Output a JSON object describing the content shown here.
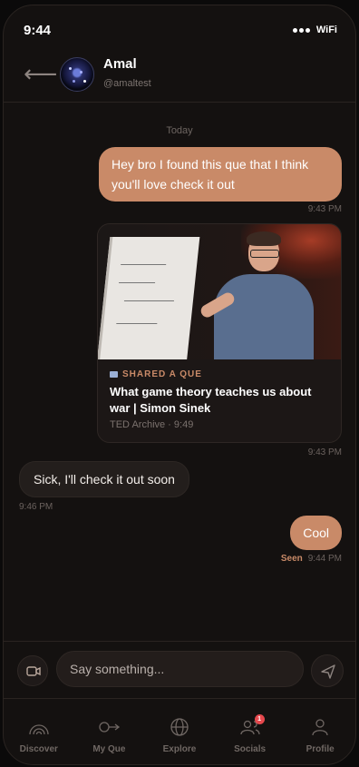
{
  "status_bar": {
    "time": "9:44",
    "wifi": "WiFi"
  },
  "header": {
    "name": "Amal",
    "handle": "@amaltest"
  },
  "chat": {
    "day_label": "Today",
    "messages": [
      {
        "text": "Hey bro I found this que that I think you'll love check it out",
        "time": "9:43 PM"
      },
      {
        "shared_label": "SHARED A QUE",
        "title": "What game theory teaches us about war | Simon Sinek",
        "meta": "TED Archive · 9:49",
        "time": "9:43 PM"
      },
      {
        "text": "Sick, I'll check it out soon",
        "time": "9:46 PM"
      },
      {
        "text": "Cool",
        "seen": "Seen",
        "time": "9:44 PM"
      }
    ]
  },
  "composer": {
    "placeholder": "Say something..."
  },
  "tabs": [
    {
      "label": "Discover",
      "icon": "radar-icon"
    },
    {
      "label": "My Que",
      "icon": "que-icon"
    },
    {
      "label": "Explore",
      "icon": "globe-icon"
    },
    {
      "label": "Socials",
      "icon": "people-icon",
      "badge": "1"
    },
    {
      "label": "Profile",
      "icon": "person-icon"
    }
  ],
  "colors": {
    "accent": "#c98a68",
    "background": "#141110",
    "badge": "#e5484d"
  }
}
